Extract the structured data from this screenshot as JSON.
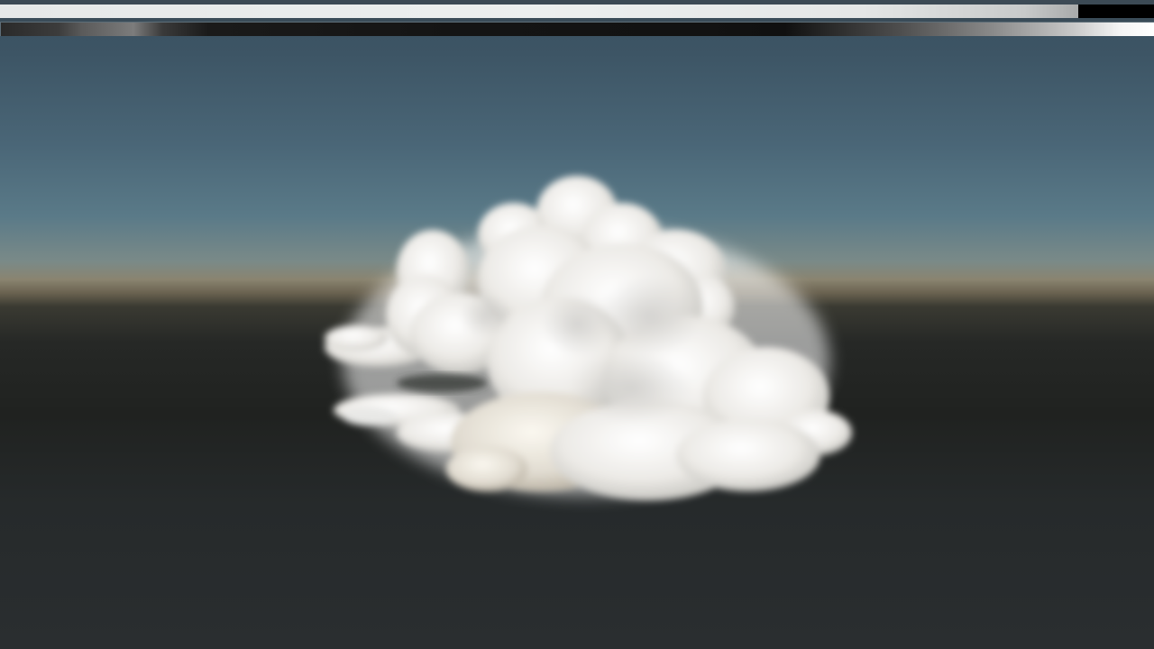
{
  "scene": {
    "type": "volumetric cloud render",
    "sky_color": "#4a6677",
    "horizon_color": "#8a8470",
    "ground_color": "#232725",
    "cloud_color": "#f2f2ee"
  },
  "bars": {
    "white_bar_fill_fraction": 0.934
  }
}
